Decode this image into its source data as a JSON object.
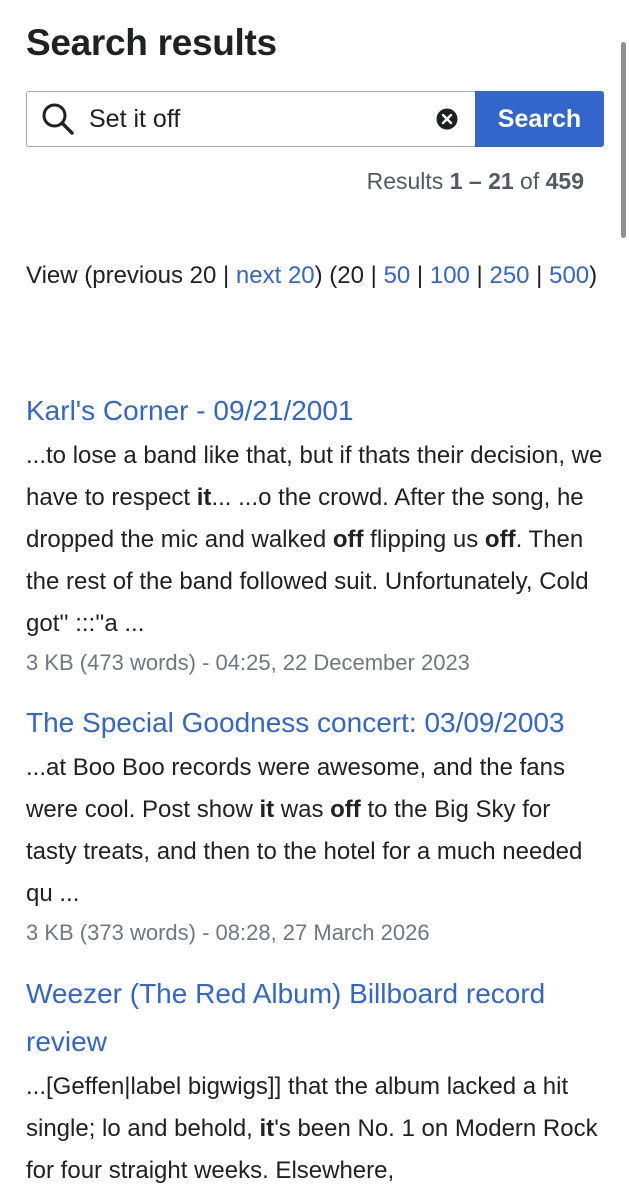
{
  "page": {
    "title": "Search results"
  },
  "search": {
    "value": "Set it off",
    "button_label": "Search"
  },
  "results_info": {
    "prefix": "Results ",
    "range": "1 – 21",
    "of": " of ",
    "total": "459"
  },
  "view": {
    "prefix": "View (previous 20 | ",
    "next": "next 20",
    "after_next": ") (20 | ",
    "sizes": [
      "50",
      "100",
      "250",
      "500"
    ],
    "sep": " | ",
    "suffix": ")"
  },
  "results": [
    {
      "title": "Karl's Corner - 09/21/2001",
      "snippet": [
        {
          "t": "...to lose a band like that, but if thats their decision, we have to respect ",
          "b": false
        },
        {
          "t": "it",
          "b": true
        },
        {
          "t": "... ...o the crowd. After the song, he dropped the mic and walked ",
          "b": false
        },
        {
          "t": "off",
          "b": true
        },
        {
          "t": " flipping us ",
          "b": false
        },
        {
          "t": "off",
          "b": true
        },
        {
          "t": ". Then the rest of the band followed suit. Unfortunately, Cold got'' :::''a ...",
          "b": false
        }
      ],
      "meta": "3 KB (473 words) - 04:25, 22 December 2023"
    },
    {
      "title": "The Special Goodness concert: 03/09/2003",
      "snippet": [
        {
          "t": "...at Boo Boo records were awesome, and the fans were cool. Post show ",
          "b": false
        },
        {
          "t": "it",
          "b": true
        },
        {
          "t": " was ",
          "b": false
        },
        {
          "t": "off",
          "b": true
        },
        {
          "t": " to the Big Sky for tasty treats, and then to the hotel for a much needed qu ...",
          "b": false
        }
      ],
      "meta": "3 KB (373 words) - 08:28, 27 March 2026"
    },
    {
      "title": "Weezer (The Red Album) Billboard record review",
      "snippet": [
        {
          "t": "...[Geffen|label bigwigs]] that the album lacked a hit single; lo and behold, ",
          "b": false
        },
        {
          "t": "it",
          "b": true
        },
        {
          "t": "'s been No. 1 on Modern Rock for four straight weeks. Elsewhere,",
          "b": false
        }
      ],
      "meta": ""
    }
  ],
  "colors": {
    "link": "#3366cc",
    "text": "#202122",
    "meta": "#72777d",
    "button": "#3366cc"
  },
  "icons": {
    "search": "magnifier-icon",
    "clear": "clear-x-icon"
  }
}
